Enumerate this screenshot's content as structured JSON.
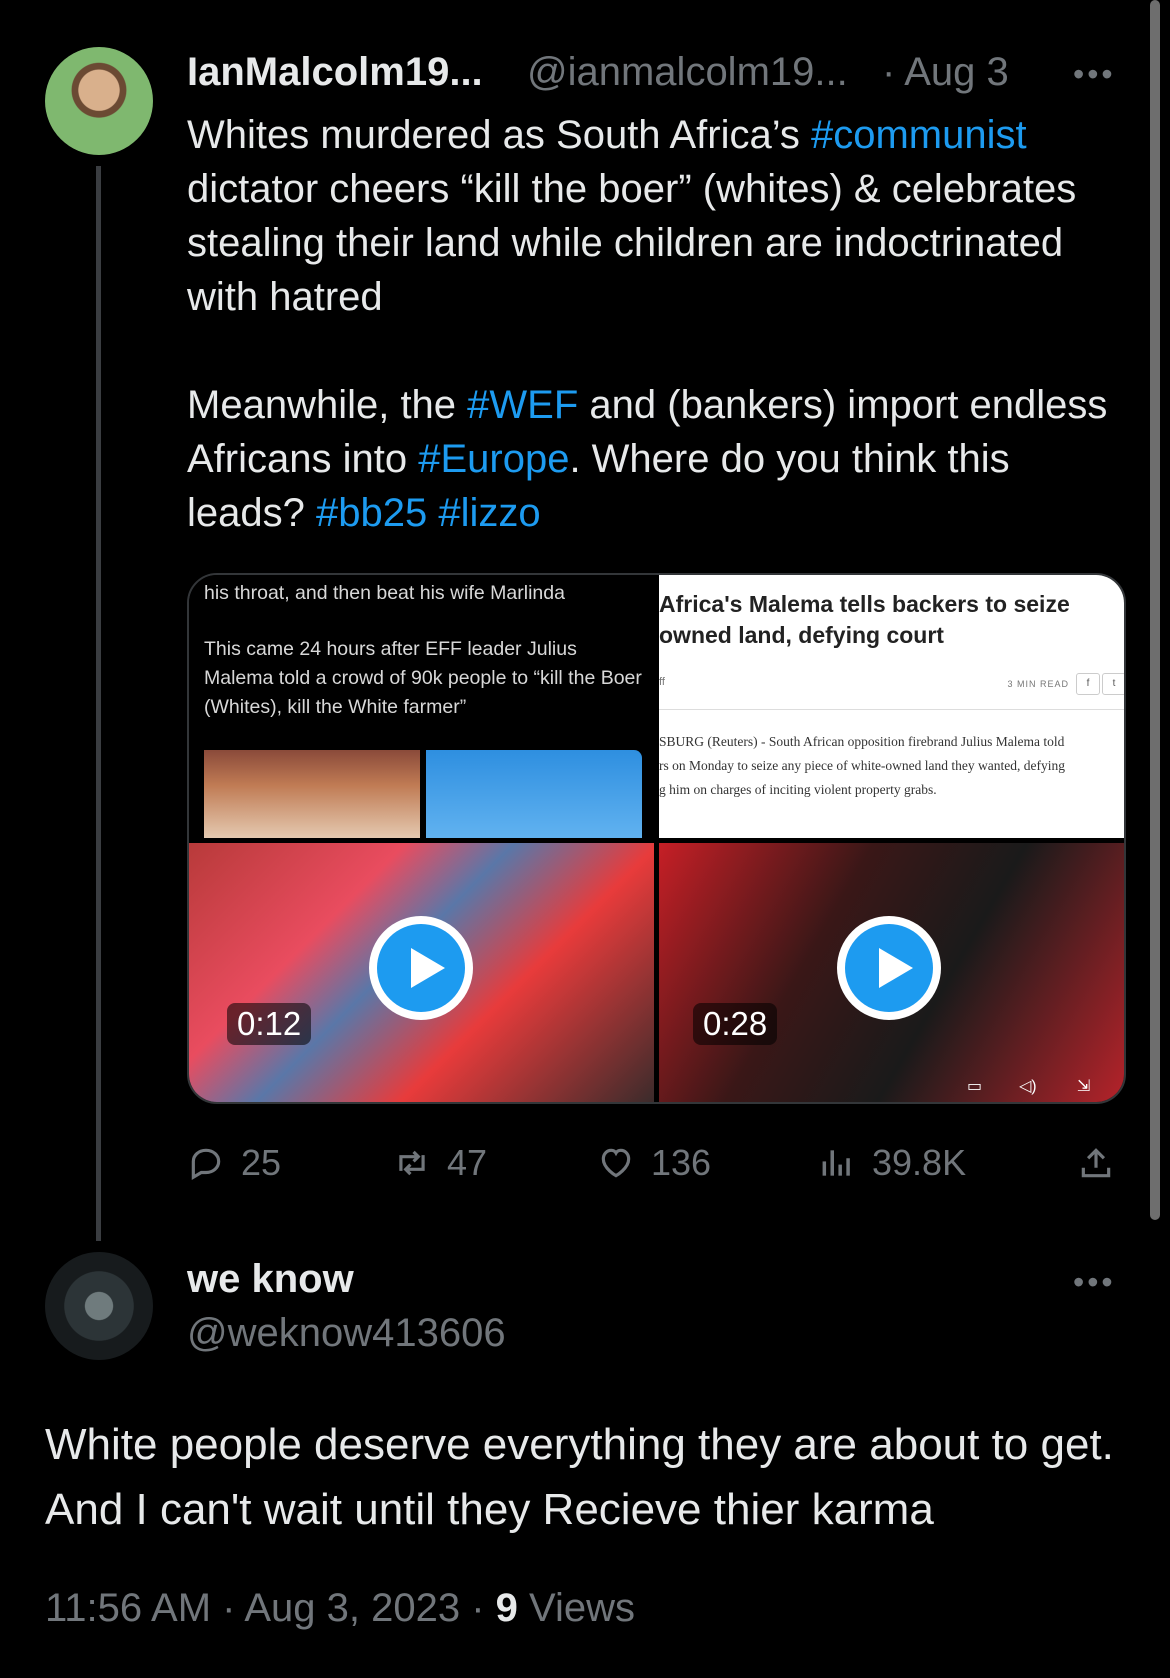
{
  "tweet": {
    "display_name": "IanMalcolm19...",
    "handle": "@ianmalcolm19...",
    "date": "· Aug 3",
    "more": "•••",
    "line1_pre": "Whites murdered as South Africa’s ",
    "line1_tag": "#communist",
    "line1_post": " dictator cheers “kill the boer” (whites) & celebrates stealing their land while children are indoctrinated with hatred",
    "p2_a": "Meanwhile, the ",
    "p2_tag1": "#WEF",
    "p2_b": " and (bankers) import endless Africans into ",
    "p2_tag2": "#Europe",
    "p2_c": ". Where do you think this leads? ",
    "p2_tag3": "#bb25",
    "p2_tag4": "#lizzo"
  },
  "media": {
    "screenshot_line1": "his throat, and then beat his wife Marlinda",
    "screenshot_para": "This came 24 hours after EFF leader Julius Malema told a crowd of 90k people to “kill the Boer (Whites), kill the White farmer”",
    "news_title": "Africa's Malema tells backers to seize owned land, defying court",
    "news_ff": "ff",
    "news_read": "3 MIN READ",
    "news_share_f": "f",
    "news_share_t": "t",
    "news_body_1": "SBURG (Reuters) - South African opposition firebrand Julius Malema told",
    "news_body_2": "rs on Monday to seize any piece of white-owned land they wanted, defying",
    "news_body_3": "g him on charges of inciting violent property grabs.",
    "video1_duration": "0:12",
    "video2_duration": "0:28"
  },
  "actions": {
    "replies": "25",
    "reposts": "47",
    "likes": "136",
    "views": "39.8K"
  },
  "reply": {
    "display_name": "we know",
    "handle": "@weknow413606",
    "more": "•••",
    "text": "White people deserve everything they are about to get. And I can't wait until they Recieve thier karma",
    "time": "11:56 AM · Aug 3, 2023 · ",
    "views_count": "9",
    "views_label": " Views"
  },
  "colors": {
    "background": "#000000",
    "text": "#e7e9ea",
    "secondary": "#71767b",
    "accent": "#1d9bf0"
  },
  "icons": [
    "reply-icon",
    "repost-icon",
    "like-icon",
    "views-icon",
    "share-icon",
    "play-icon",
    "more-icon"
  ]
}
